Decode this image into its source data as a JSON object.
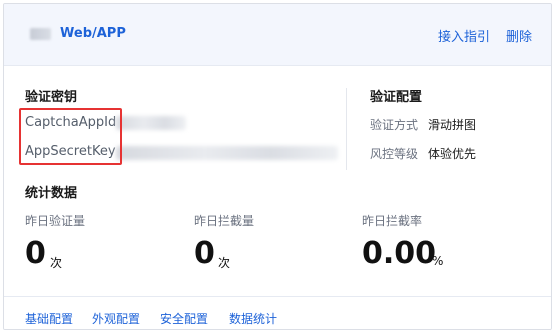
{
  "header": {
    "app_type": "Web/APP",
    "links": {
      "access_guide": "接入指引",
      "delete": "删除"
    }
  },
  "keys": {
    "title": "验证密钥",
    "app_id_label": "CaptchaAppId",
    "app_secret_label": "AppSecretKey"
  },
  "config": {
    "title": "验证配置",
    "verify_mode_label": "验证方式",
    "verify_mode_value": "滑动拼图",
    "risk_level_label": "风控等级",
    "risk_level_value": "体验优先"
  },
  "stats": {
    "title": "统计数据",
    "items": [
      {
        "label": "昨日验证量",
        "value": "0",
        "unit": "次"
      },
      {
        "label": "昨日拦截量",
        "value": "0",
        "unit": "次"
      },
      {
        "label": "昨日拦截率",
        "value": "0.00",
        "unit": "%"
      }
    ]
  },
  "footer": {
    "links": [
      "基础配置",
      "外观配置",
      "安全配置",
      "数据统计"
    ]
  },
  "colors": {
    "accent": "#1d62d8",
    "header_bg": "#f3f6fd",
    "highlight": "#e63333"
  }
}
